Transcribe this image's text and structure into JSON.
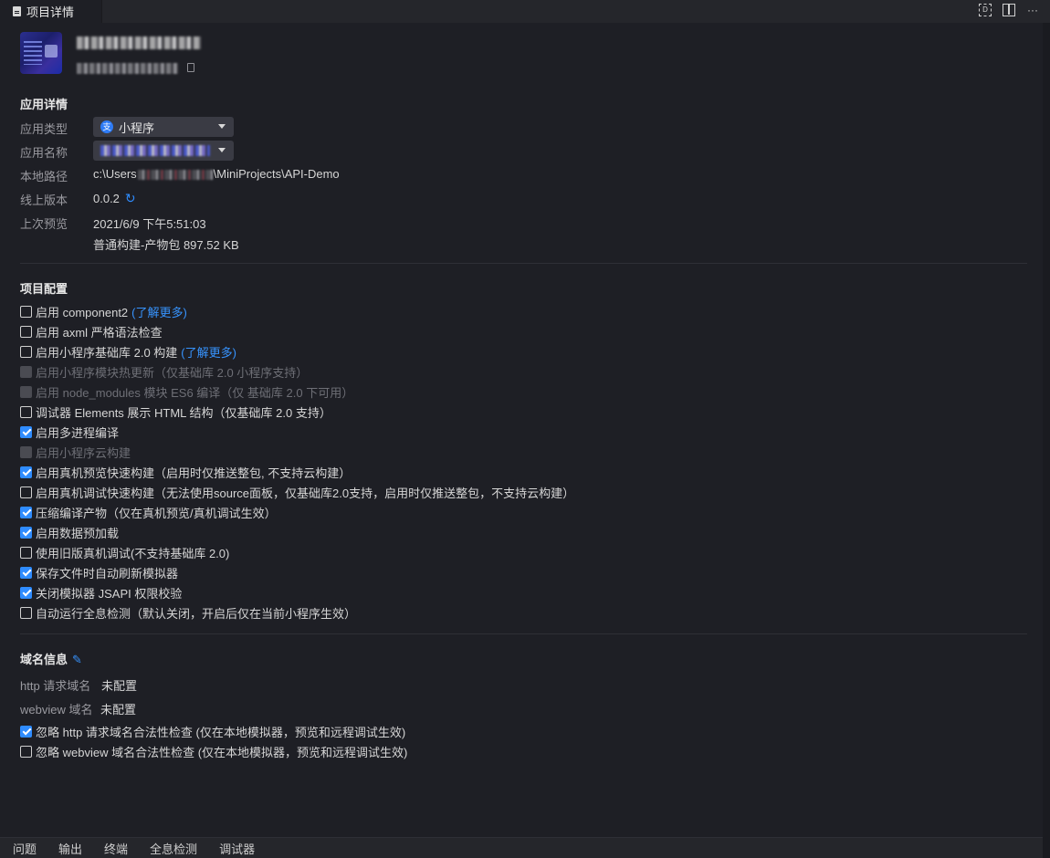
{
  "tab": {
    "title": "项目详情"
  },
  "toolbar": {
    "preview_icon": "preview-icon",
    "split_icon": "split-editor-icon",
    "more_icon": "more-icon"
  },
  "app_details": {
    "section_title": "应用详情",
    "type_label": "应用类型",
    "type_value": "小程序",
    "name_label": "应用名称",
    "path_label": "本地路径",
    "path_prefix": "c:\\Users",
    "path_suffix": "\\MiniProjects\\API-Demo",
    "version_label": "线上版本",
    "version_value": "0.0.2",
    "last_preview_label": "上次预览",
    "last_preview_time": "2021/6/9 下午5:51:03",
    "last_preview_build": "普通构建-产物包 897.52 KB"
  },
  "project_config": {
    "section_title": "项目配置",
    "items": [
      {
        "label": "启用 component2",
        "link": "(了解更多)",
        "checked": false,
        "disabled": false
      },
      {
        "label": "启用 axml 严格语法检查",
        "checked": false,
        "disabled": false
      },
      {
        "label": "启用小程序基础库 2.0 构建",
        "link": "(了解更多)",
        "checked": false,
        "disabled": false
      },
      {
        "label": "启用小程序模块热更新（仅基础库 2.0 小程序支持）",
        "checked": false,
        "disabled": true
      },
      {
        "label": "启用 node_modules 模块 ES6 编译（仅 基础库 2.0 下可用）",
        "checked": false,
        "disabled": true
      },
      {
        "label": "调试器 Elements 展示 HTML 结构（仅基础库 2.0 支持）",
        "checked": false,
        "disabled": false
      },
      {
        "label": "启用多进程编译",
        "checked": true,
        "disabled": false
      },
      {
        "label": "启用小程序云构建",
        "checked": false,
        "disabled": true
      },
      {
        "label": "启用真机预览快速构建（启用时仅推送整包, 不支持云构建）",
        "checked": true,
        "disabled": false
      },
      {
        "label": "启用真机调试快速构建（无法使用source面板，仅基础库2.0支持，启用时仅推送整包，不支持云构建）",
        "checked": false,
        "disabled": false
      },
      {
        "label": "压缩编译产物（仅在真机预览/真机调试生效）",
        "checked": true,
        "disabled": false
      },
      {
        "label": "启用数据预加载",
        "checked": true,
        "disabled": false
      },
      {
        "label": "使用旧版真机调试(不支持基础库 2.0)",
        "checked": false,
        "disabled": false
      },
      {
        "label": "保存文件时自动刷新模拟器",
        "checked": true,
        "disabled": false
      },
      {
        "label": "关闭模拟器 JSAPI 权限校验",
        "checked": true,
        "disabled": false
      },
      {
        "label": "自动运行全息检测（默认关闭，开启后仅在当前小程序生效）",
        "checked": false,
        "disabled": false
      }
    ]
  },
  "domain_info": {
    "section_title": "域名信息",
    "http_label": "http 请求域名",
    "http_value": "未配置",
    "webview_label": "webview 域名",
    "webview_value": "未配置",
    "ignore_http": {
      "label": "忽略 http 请求域名合法性检查 (仅在本地模拟器，预览和远程调试生效)",
      "checked": true
    },
    "ignore_webview": {
      "label": "忽略 webview 域名合法性检查 (仅在本地模拟器，预览和远程调试生效)",
      "checked": false
    }
  },
  "panel_tabs": [
    "问题",
    "输出",
    "终端",
    "全息检测",
    "调试器"
  ],
  "colors": {
    "accent": "#2f8cff",
    "background": "#1e1f25"
  }
}
